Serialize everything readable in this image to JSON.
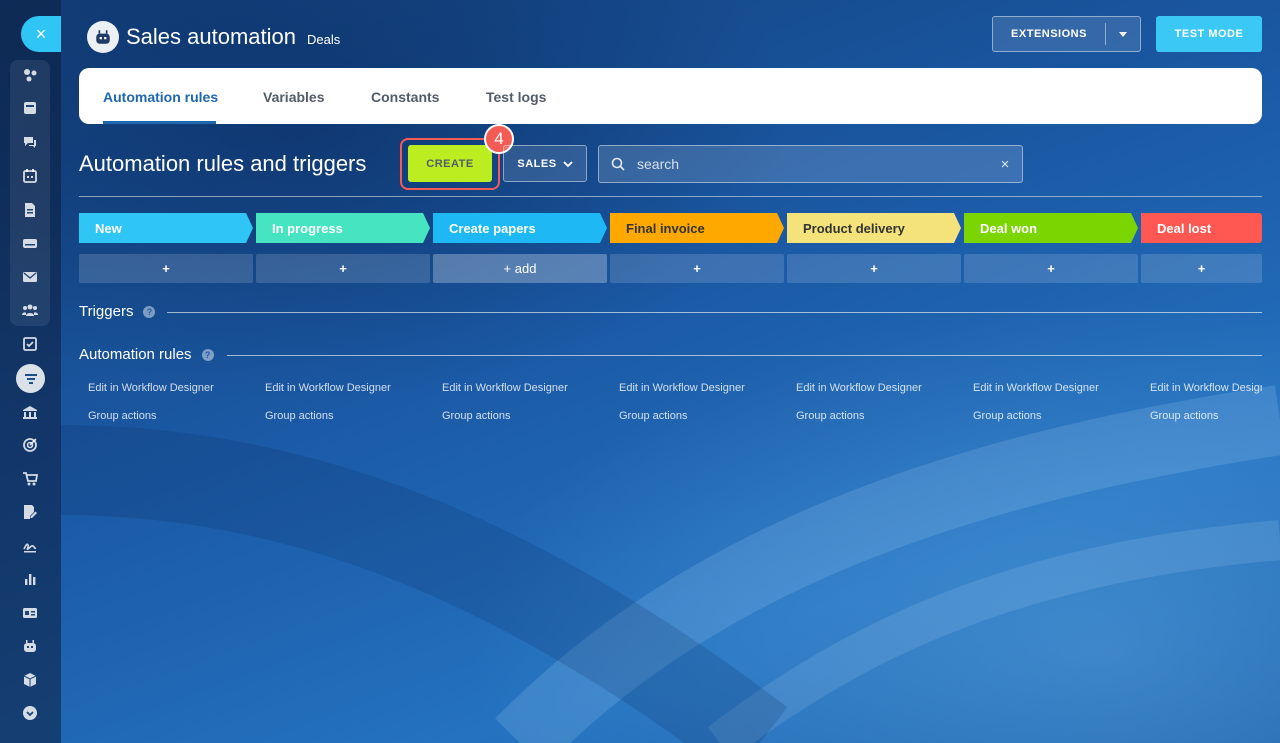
{
  "sidebar": {
    "close_label": "×",
    "icons": [
      "activity-stream-icon",
      "tasks-icon",
      "chat-icon",
      "calendar-icon",
      "document-icon",
      "drive-icon",
      "mail-icon",
      "groups-icon",
      "checklist-icon",
      "crm-funnel-icon",
      "company-icon",
      "target-icon",
      "cart-icon",
      "edit-icon",
      "signature-icon",
      "analytics-icon",
      "contact-center-icon",
      "robot-icon",
      "market-icon",
      "more-icon"
    ]
  },
  "header": {
    "title": "Sales automation",
    "subtitle": "Deals",
    "extensions_label": "EXTENSIONS",
    "test_mode_label": "TEST MODE"
  },
  "tabs": [
    {
      "label": "Automation rules",
      "active": true
    },
    {
      "label": "Variables",
      "active": false
    },
    {
      "label": "Constants",
      "active": false
    },
    {
      "label": "Test logs",
      "active": false
    }
  ],
  "toolbar": {
    "title": "Automation rules and triggers",
    "create_label": "CREATE",
    "step_badge": "4",
    "pipeline_label": "SALES",
    "search_placeholder": "search",
    "clear_label": "×"
  },
  "stages": [
    {
      "name": "New",
      "color": "#2fc6f6"
    },
    {
      "name": "In progress",
      "color": "#47e4c2"
    },
    {
      "name": "Create papers",
      "color": "#1eb8f5"
    },
    {
      "name": "Final invoice",
      "color": "#ffa900"
    },
    {
      "name": "Product delivery",
      "color": "#f3e37a"
    },
    {
      "name": "Deal won",
      "color": "#7bd500"
    },
    {
      "name": "Deal lost",
      "color": "#ff5752"
    }
  ],
  "add_cells": [
    "+",
    "+",
    "+ add",
    "+",
    "+",
    "+",
    "+"
  ],
  "sections": {
    "triggers": "Triggers",
    "automation_rules": "Automation rules",
    "help": "?"
  },
  "column_links": {
    "edit": "Edit in Workflow Designer",
    "group": "Group actions"
  }
}
